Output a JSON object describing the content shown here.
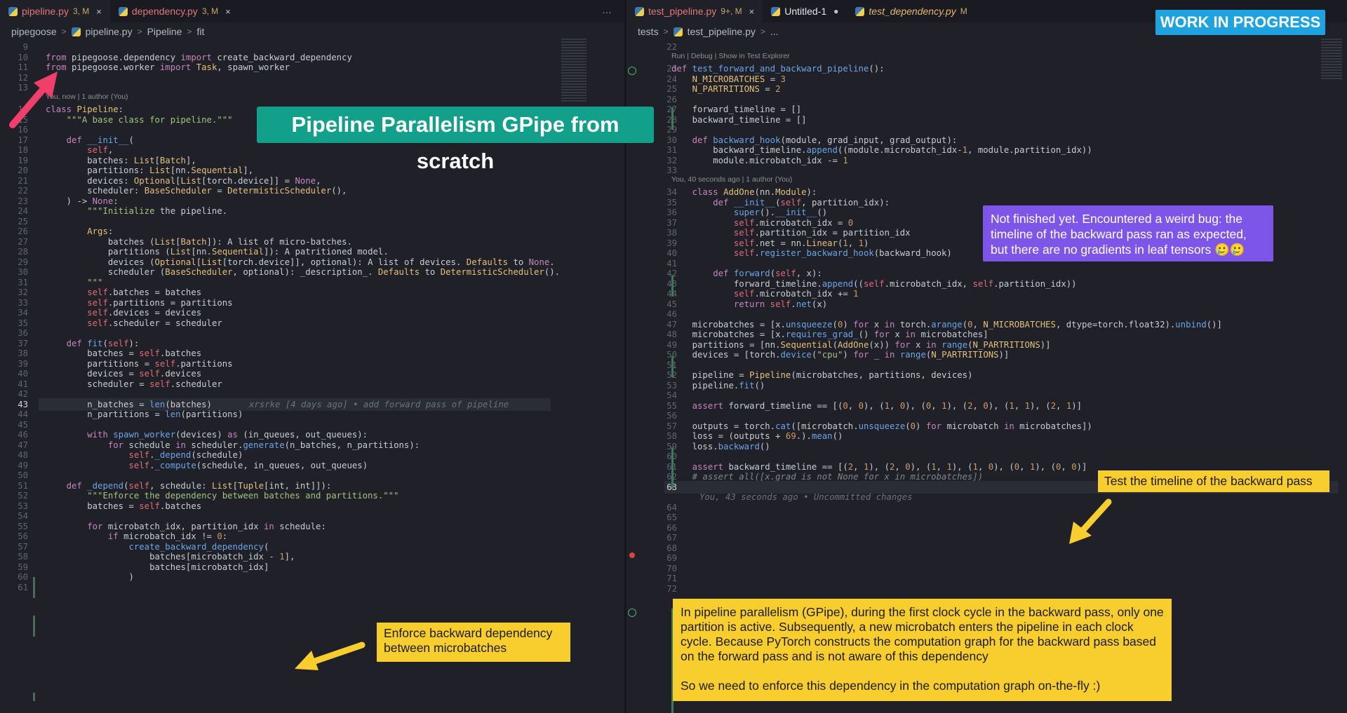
{
  "left": {
    "tabs": [
      {
        "name": "pipeline.py",
        "badge": "3, M",
        "active": true,
        "cls": "err"
      },
      {
        "name": "dependency.py",
        "badge": "3, M",
        "active": false,
        "cls": "err"
      }
    ],
    "more_icon": "…",
    "breadcrumb": [
      "pipegoose",
      "pipeline.py",
      "Pipeline",
      "fit"
    ],
    "blame_header_1": "You, now | 1 author (You)",
    "inline_blame": "xrsrke [4 days ago] • add forward pass of pipeline",
    "current_line": "43",
    "lines": [
      [
        "9",
        ""
      ],
      [
        "10",
        "from pipegoose.dependency import create_backward_dependency"
      ],
      [
        "11",
        "from pipegoose.worker import Task, spawn_worker"
      ],
      [
        "12",
        ""
      ],
      [
        "13",
        ""
      ],
      [
        "14",
        "class Pipeline:"
      ],
      [
        "15",
        "    \"\"\"A base class for pipeline.\"\"\""
      ],
      [
        "16",
        ""
      ],
      [
        "17",
        "    def __init__("
      ],
      [
        "18",
        "        self,"
      ],
      [
        "19",
        "        batches: List[Batch],"
      ],
      [
        "20",
        "        partitions: List[nn.Sequential],"
      ],
      [
        "21",
        "        devices: Optional[List[torch.device]] = None,"
      ],
      [
        "22",
        "        scheduler: BaseScheduler = DetermisticScheduler(),"
      ],
      [
        "23",
        "    ) -> None:"
      ],
      [
        "24",
        "        \"\"\"Initialize the pipeline."
      ],
      [
        "25",
        ""
      ],
      [
        "26",
        "        Args:"
      ],
      [
        "27",
        "            batches (List[Batch]): A list of micro-batches."
      ],
      [
        "28",
        "            partitions (List[nn.Sequential]): A patritioned model."
      ],
      [
        "29",
        "            devices (Optional[List[torch.device]], optional): A list of devices. Defaults to None."
      ],
      [
        "30",
        "            scheduler (BaseScheduler, optional): _description_. Defaults to DetermisticScheduler()."
      ],
      [
        "31",
        "        \"\"\""
      ],
      [
        "32",
        "        self.batches = batches"
      ],
      [
        "33",
        "        self.partitions = partitions"
      ],
      [
        "34",
        "        self.devices = devices"
      ],
      [
        "35",
        "        self.scheduler = scheduler"
      ],
      [
        "36",
        ""
      ],
      [
        "37",
        "    def fit(self):"
      ],
      [
        "38",
        "        batches = self.batches"
      ],
      [
        "39",
        "        partitions = self.partitions"
      ],
      [
        "40",
        "        devices = self.devices"
      ],
      [
        "41",
        "        scheduler = self.scheduler"
      ],
      [
        "42",
        ""
      ],
      [
        "43",
        "        n_batches = len(batches)"
      ],
      [
        "44",
        "        n_partitions = len(partitions)"
      ],
      [
        "45",
        ""
      ],
      [
        "46",
        "        with spawn_worker(devices) as (in_queues, out_queues):"
      ],
      [
        "47",
        "            for schedule in scheduler.generate(n_batches, n_partitions):"
      ],
      [
        "48",
        "                self._depend(schedule)"
      ],
      [
        "49",
        "                self._compute(schedule, in_queues, out_queues)"
      ],
      [
        "50",
        ""
      ],
      [
        "51",
        "    def _depend(self, schedule: List[Tuple[int, int]]):"
      ],
      [
        "52",
        "        \"\"\"Enforce the dependency between batches and partitions.\"\"\""
      ],
      [
        "53",
        "        batches = self.batches"
      ],
      [
        "54",
        ""
      ],
      [
        "55",
        "        for microbatch_idx, partition_idx in schedule:"
      ],
      [
        "56",
        "            if microbatch_idx != 0:"
      ],
      [
        "57",
        "                create_backward_dependency("
      ],
      [
        "58",
        "                    batches[microbatch_idx - 1],"
      ],
      [
        "59",
        "                    batches[microbatch_idx]"
      ],
      [
        "60",
        "                )"
      ],
      [
        "61",
        ""
      ]
    ]
  },
  "right": {
    "tabs": [
      {
        "name": "test_pipeline.py",
        "badge": "9+, M",
        "active": true,
        "cls": "err",
        "close": "×"
      },
      {
        "name": "Untitled-1",
        "badge": "",
        "active": false,
        "cls": "",
        "dot": "●"
      },
      {
        "name": "test_dependency.py",
        "badge": "M",
        "active": false,
        "cls": "ital mod"
      }
    ],
    "breadcrumb": [
      "tests",
      "test_pipeline.py",
      "..."
    ],
    "codelens": "Run | Debug | Show in Test Explorer",
    "blame_header_2": "You, 40 seconds ago | 1 author (You)",
    "inline_blame": "You, 43 seconds ago • Uncommitted changes",
    "current_line": "63",
    "lines": [
      [
        "22",
        ""
      ],
      [
        "23",
        "def test_forward_and_backward_pipeline():"
      ],
      [
        "24",
        "    N_MICROBATCHES = 3"
      ],
      [
        "25",
        "    N_PARTRITIONS = 2"
      ],
      [
        "26",
        ""
      ],
      [
        "27",
        "    forward_timeline = []"
      ],
      [
        "28",
        "    backward_timeline = []"
      ],
      [
        "29",
        ""
      ],
      [
        "30",
        "    def backward_hook(module, grad_input, grad_output):"
      ],
      [
        "31",
        "        backward_timeline.append((module.microbatch_idx-1, module.partition_idx))"
      ],
      [
        "32",
        "        module.microbatch_idx -= 1"
      ],
      [
        "33",
        ""
      ],
      [
        "34",
        "    class AddOne(nn.Module):"
      ],
      [
        "35",
        "        def __init__(self, partition_idx):"
      ],
      [
        "36",
        "            super().__init__()"
      ],
      [
        "37",
        "            self.microbatch_idx = 0"
      ],
      [
        "38",
        "            self.partition_idx = partition_idx"
      ],
      [
        "39",
        "            self.net = nn.Linear(1, 1)"
      ],
      [
        "40",
        "            self.register_backward_hook(backward_hook)"
      ],
      [
        "41",
        ""
      ],
      [
        "42",
        "        def forward(self, x):"
      ],
      [
        "43",
        "            forward_timeline.append((self.microbatch_idx, self.partition_idx))"
      ],
      [
        "44",
        "            self.microbatch_idx += 1"
      ],
      [
        "45",
        "            return self.net(x)"
      ],
      [
        "46",
        ""
      ],
      [
        "47",
        "    microbatches = [x.unsqueeze(0) for x in torch.arange(0, N_MICROBATCHES, dtype=torch.float32).unbind()]"
      ],
      [
        "48",
        "    microbatches = [x.requires_grad_() for x in microbatches]"
      ],
      [
        "49",
        "    partitions = [nn.Sequential(AddOne(x)) for x in range(N_PARTRITIONS)]"
      ],
      [
        "50",
        "    devices = [torch.device(\"cpu\") for _ in range(N_PARTRITIONS)]"
      ],
      [
        "51",
        ""
      ],
      [
        "52",
        "    pipeline = Pipeline(microbatches, partitions, devices)"
      ],
      [
        "53",
        "    pipeline.fit()"
      ],
      [
        "54",
        ""
      ],
      [
        "55",
        "    assert forward_timeline == [(0, 0), (1, 0), (0, 1), (2, 0), (1, 1), (2, 1)]"
      ],
      [
        "56",
        ""
      ],
      [
        "57",
        "    outputs = torch.cat([microbatch.unsqueeze(0) for microbatch in microbatches])"
      ],
      [
        "58",
        "    loss = (outputs + 69.).mean()"
      ],
      [
        "59",
        "    loss.backward()"
      ],
      [
        "60",
        ""
      ],
      [
        "61",
        "    assert backward_timeline == [(2, 1), (2, 0), (1, 1), (1, 0), (0, 1), (0, 0)]"
      ],
      [
        "62",
        "    # assert all([x.grad is not None for x in microbatches])"
      ],
      [
        "63",
        ""
      ],
      [
        "64",
        ""
      ],
      [
        "65",
        ""
      ],
      [
        "66",
        ""
      ],
      [
        "67",
        ""
      ],
      [
        "68",
        ""
      ],
      [
        "69",
        ""
      ],
      [
        "70",
        ""
      ],
      [
        "71",
        ""
      ],
      [
        "72",
        ""
      ]
    ]
  },
  "overlays": {
    "title": "Pipeline Parallelism GPipe from scratch",
    "wip": "WORK IN PROGRESS",
    "purple_note": "Not finished yet. Encountered a weird bug: the timeline of the backward pass ran as expected, but there are no gradients in leaf tensors 🥲🥲",
    "timeline_note": "Test the timeline of the backward pass",
    "enforce_note": "Enforce backward dependency between microbatches",
    "explain_p1": "In pipeline parallelism (GPipe), during the first clock cycle in the backward pass, only one partition is active. Subsequently, a new microbatch enters the pipeline in each clock cycle. Because PyTorch constructs the computation graph for the backward pass based on the forward pass and is not aware of this dependency",
    "explain_p2": "So we need to enforce this dependency in the computation graph on-the-fly :)"
  },
  "colors": {
    "banner": "#12a08a",
    "wip": "#1fa3e0",
    "purple": "#7d56e9",
    "yellow": "#f8cd2e",
    "arrow_pink": "#f0406a",
    "arrow_yellow": "#f8cd2e"
  }
}
